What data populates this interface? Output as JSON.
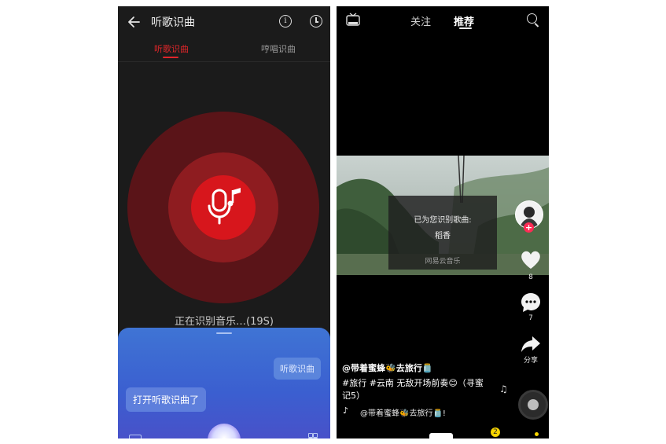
{
  "left_screen": {
    "header": {
      "title": "听歌识曲"
    },
    "tabs": [
      {
        "label": "听歌识曲",
        "active": true
      },
      {
        "label": "哼唱识曲",
        "active": false
      }
    ],
    "status_text": "正在识别音乐…(19S)",
    "assistant": {
      "user_query": "听歌识曲",
      "assistant_reply": "打开听歌识曲了"
    },
    "colors": {
      "accent": "#e0262a",
      "ring_outer": "#5a1418",
      "ring_mid": "#8e1c20",
      "ring_inner": "#d7161c",
      "panel": "#3f74d4"
    }
  },
  "right_screen": {
    "nav": {
      "follow": "关注",
      "recommend": "推荐",
      "live_badge": "直播"
    },
    "popup": {
      "title": "已为您识别歌曲:",
      "song": "稻香",
      "watermark": "网易云音乐"
    },
    "side": {
      "like_count": "8",
      "comment_count": "7",
      "share_label": "分享"
    },
    "caption": {
      "author": "@带着蜜蜂🐝去旅行🫙",
      "text": "#旅行 #云南 无敌开场前奏😊（寻蜜记5）",
      "sound": "@带着蜜蜂🐝去旅行🫙!"
    },
    "badge_count": "2",
    "colors": {
      "plus": "#fe2c55",
      "badge": "#f7d500"
    }
  }
}
